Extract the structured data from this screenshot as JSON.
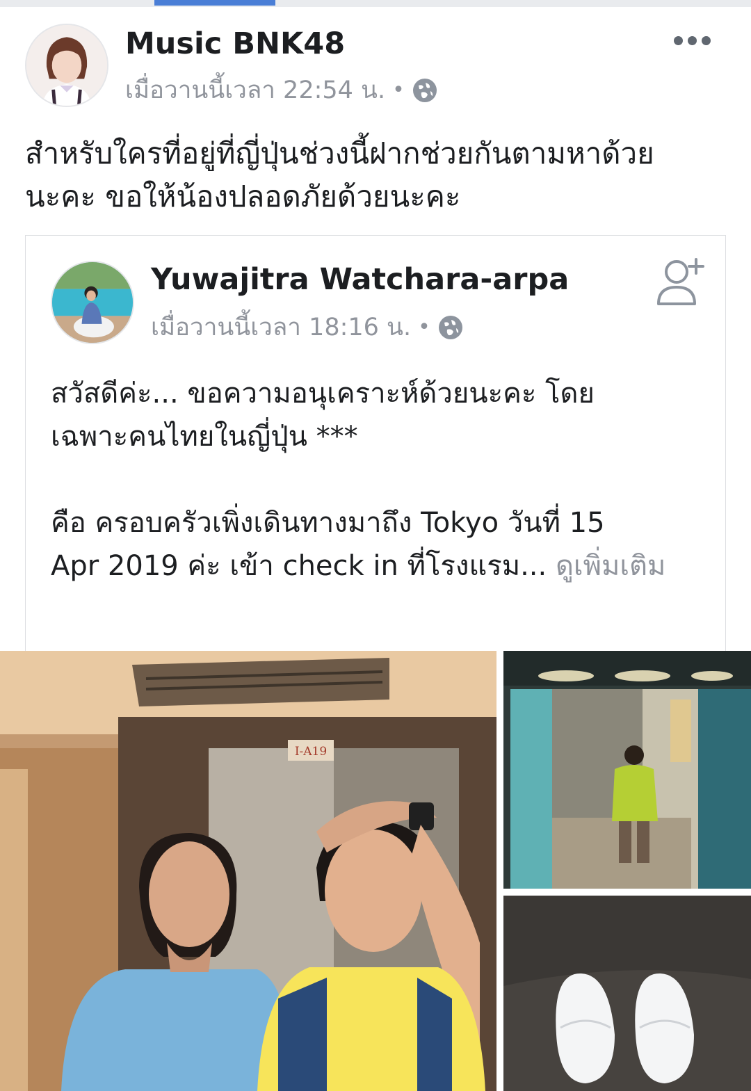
{
  "post": {
    "author": "Music BNK48",
    "timestamp": "เมื่อวานนี้เวลา 22:54 น.",
    "separator": "•",
    "privacy_icon": "globe-icon",
    "more_icon": "more-horizontal-icon",
    "text_line1": "สำหรับใครที่อยู่ที่ญี่ปุ่นช่วงนี้ฝากช่วยกันตามหาด้วย",
    "text_line2": "นะคะ ขอให้น้องปลอดภัยด้วยนะคะ"
  },
  "shared": {
    "author": "Yuwajitra Watchara-arpa",
    "timestamp": "เมื่อวานนี้เวลา 18:16 น.",
    "separator": "•",
    "privacy_icon": "globe-icon",
    "add_friend_icon": "add-friend-icon",
    "paragraph1_line1": "สวัสดีค่ะ... ขอความอนุเคราะห์ด้วยนะคะ โดย",
    "paragraph1_line2": "เฉพาะคนไทยในญี่ปุ่น ***",
    "paragraph2_line1": "คือ ครอบครัวเพิ่งเดินทางมาถึง Tokyo วันที่ 15",
    "paragraph2_line2": "Apr 2019 ค่ะ  เข้า check in ที่โรงแรม...",
    "see_more": "ดูเพิ่มเติม"
  },
  "photos": {
    "elevator_sign": "I-A19"
  },
  "colors": {
    "accent": "#4a7ed6",
    "meta_text": "#90949c",
    "border": "#dddfe2"
  }
}
